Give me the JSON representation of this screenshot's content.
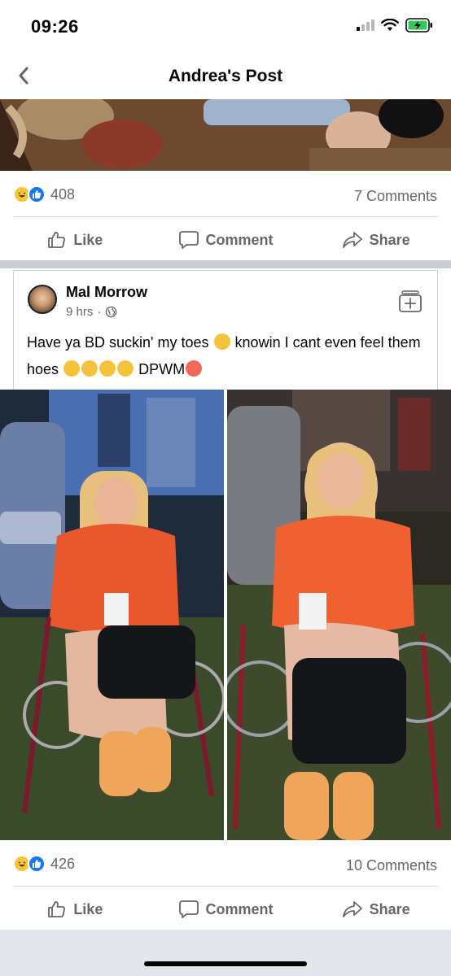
{
  "status_bar": {
    "time": "09:26"
  },
  "nav": {
    "title": "Andrea's Post"
  },
  "post1": {
    "reaction_count": "408",
    "comments": "7 Comments"
  },
  "actions": {
    "like": "Like",
    "comment": "Comment",
    "share": "Share"
  },
  "shared_post": {
    "author": "Mal Morrow",
    "time": "9 hrs",
    "dot": "·",
    "text_part1": "Have ya BD suckin' my toes",
    "text_part2": "knowin I cant even feel them hoes",
    "text_part3": "DPWM"
  },
  "post2": {
    "reaction_count": "426",
    "comments": "10 Comments"
  },
  "icons": {
    "back": "chevron-left-icon",
    "haha": "haha-reaction-icon",
    "like_reaction": "like-reaction-icon",
    "like": "thumbs-up-icon",
    "comment": "speech-bubble-icon",
    "share": "share-arrow-icon",
    "globe": "globe-icon",
    "save": "save-icon",
    "signal": "signal-icon",
    "wifi": "wifi-icon",
    "battery": "battery-charging-icon"
  },
  "colors": {
    "facebook_blue": "#1877f2",
    "haha_yellow": "#f7c53c",
    "secondary_text": "#65676b",
    "battery_green": "#34c759"
  }
}
